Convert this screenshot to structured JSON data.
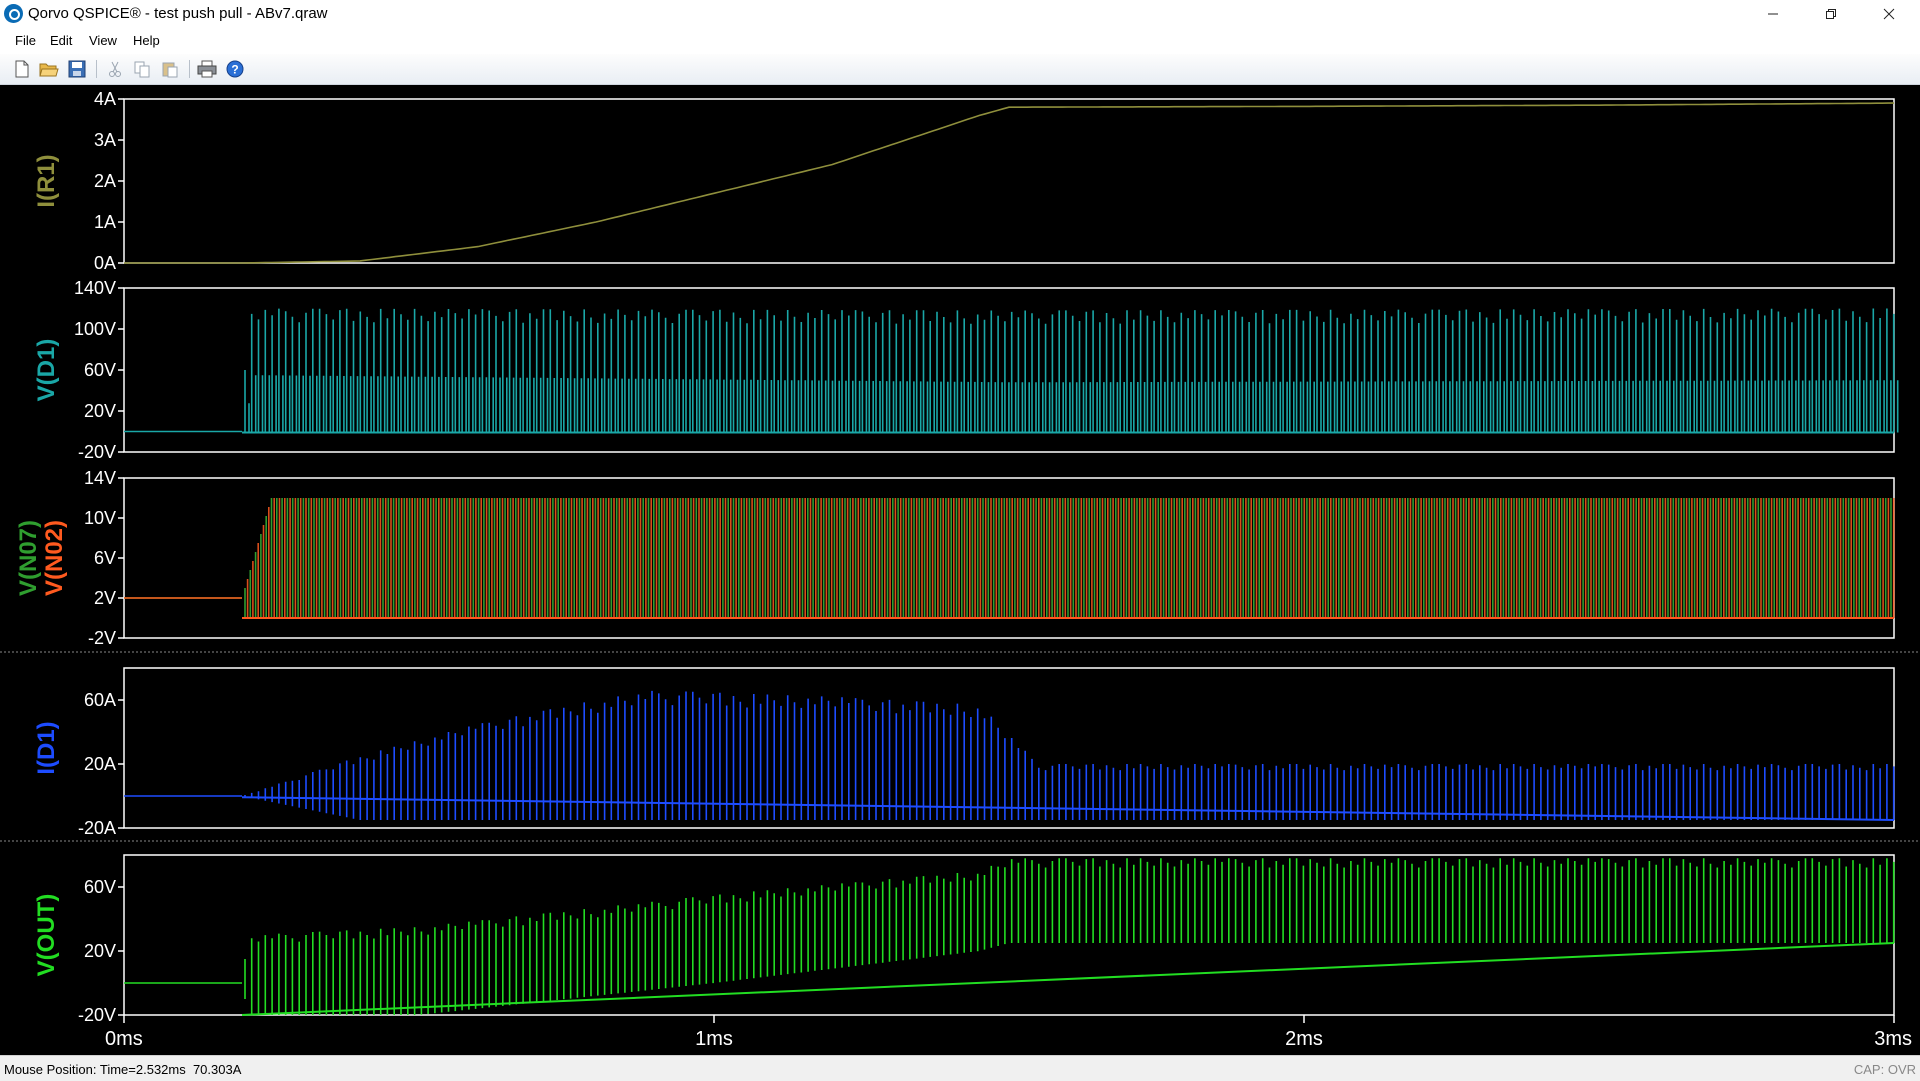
{
  "window": {
    "title": "Qorvo QSPICE® - test push pull - ABv7.qraw",
    "app_icon": "qspice-logo-icon",
    "controls": [
      "minimize-icon",
      "restore-icon",
      "close-icon"
    ]
  },
  "menu": {
    "items": [
      "File",
      "Edit",
      "View",
      "Help"
    ]
  },
  "toolbar": {
    "buttons": [
      "new-file-icon",
      "open-folder-icon",
      "save-icon",
      "cut-icon",
      "copy-icon",
      "paste-icon",
      "print-icon",
      "help-icon"
    ]
  },
  "colors": {
    "background": "#000000",
    "axis": "#ffffff",
    "i_r1": "#8f8f3c",
    "v_d1": "#1aa7a7",
    "v_n07": "#2f9e2f",
    "v_n02": "#ff5a1f",
    "i_d1": "#1d4cff",
    "v_out": "#22dd22"
  },
  "chart_data": [
    {
      "type": "line",
      "series": [
        {
          "name": "I(R1)",
          "x": [
            0,
            0.2,
            0.4,
            0.6,
            0.8,
            1.0,
            1.2,
            1.45,
            1.5,
            2.0,
            2.5,
            3.0
          ],
          "y": [
            0,
            0,
            0.05,
            0.4,
            1.0,
            1.7,
            2.4,
            3.6,
            3.8,
            3.82,
            3.85,
            3.9
          ]
        }
      ],
      "ylim": [
        0,
        4
      ],
      "yticks": [
        "4A",
        "3A",
        "2A",
        "1A",
        "0A"
      ],
      "yticks_values": [
        4,
        3,
        2,
        1,
        0
      ],
      "xlim": [
        0,
        3
      ]
    },
    {
      "type": "line",
      "series": [
        {
          "name": "V(D1)",
          "x": [
            0,
            0.2,
            0.21,
            1.5,
            3.0
          ],
          "y_peak": [
            0,
            0,
            120,
            118,
            120
          ],
          "y_mid": [
            0,
            0,
            55,
            48,
            50
          ],
          "y_floor": [
            0,
            0,
            -1,
            -1,
            -1
          ]
        }
      ],
      "ylim": [
        -20,
        140
      ],
      "yticks": [
        "140V",
        "100V",
        "60V",
        "20V",
        "-20V"
      ],
      "yticks_values": [
        140,
        100,
        60,
        20,
        -20
      ],
      "xlim": [
        0,
        3
      ]
    },
    {
      "type": "line",
      "series": [
        {
          "name": "V(N07)",
          "x": [
            0,
            0.2,
            0.25,
            3.0
          ],
          "y_peak": [
            2,
            2,
            12,
            12
          ],
          "y_floor": [
            0,
            0,
            0,
            0
          ]
        },
        {
          "name": "V(N02)",
          "x": [
            0,
            0.2,
            0.25,
            3.0
          ],
          "y_peak": [
            2,
            2,
            12,
            12
          ],
          "y_floor": [
            0,
            0,
            0,
            0
          ]
        }
      ],
      "ylim": [
        -2,
        14
      ],
      "yticks": [
        "14V",
        "10V",
        "6V",
        "2V",
        "-2V"
      ],
      "yticks_values": [
        14,
        10,
        6,
        2,
        -2
      ],
      "xlim": [
        0,
        3
      ]
    },
    {
      "type": "line",
      "series": [
        {
          "name": "I(D1)",
          "x": [
            0,
            0.2,
            0.4,
            0.6,
            0.8,
            0.9,
            1.2,
            1.45,
            1.55,
            2.0,
            3.0
          ],
          "y_peak": [
            0,
            0,
            25,
            45,
            60,
            66,
            62,
            57,
            20,
            20,
            20
          ],
          "y_floor": [
            0,
            0,
            -15,
            -15,
            -15,
            -15,
            -15,
            -15,
            -15,
            -15,
            -15
          ]
        }
      ],
      "ylim": [
        -20,
        80
      ],
      "yticks": [
        "60A",
        "20A",
        "-20A"
      ],
      "yticks_values": [
        60,
        20,
        -20
      ],
      "xlim": [
        0,
        3
      ]
    },
    {
      "type": "line",
      "series": [
        {
          "name": "V(OUT)",
          "x": [
            0,
            0.2,
            0.21,
            0.5,
            1.0,
            1.45,
            1.5,
            3.0
          ],
          "y_peak": [
            0,
            0,
            30,
            35,
            55,
            70,
            78,
            78
          ],
          "y_floor": [
            0,
            0,
            -20,
            -20,
            0,
            20,
            25,
            25
          ]
        }
      ],
      "ylim": [
        -20,
        80
      ],
      "yticks": [
        "60V",
        "20V",
        "-20V"
      ],
      "yticks_values": [
        60,
        20,
        -20
      ],
      "xlim": [
        0,
        3
      ]
    }
  ],
  "x_axis": {
    "ticks": [
      "0ms",
      "1ms",
      "2ms",
      "3ms"
    ],
    "tick_values": [
      0,
      1,
      2,
      3
    ]
  },
  "status": {
    "mouse_position": "Mouse Position: Time=2.532ms  70.303A",
    "mode": "CAP: OVR"
  }
}
